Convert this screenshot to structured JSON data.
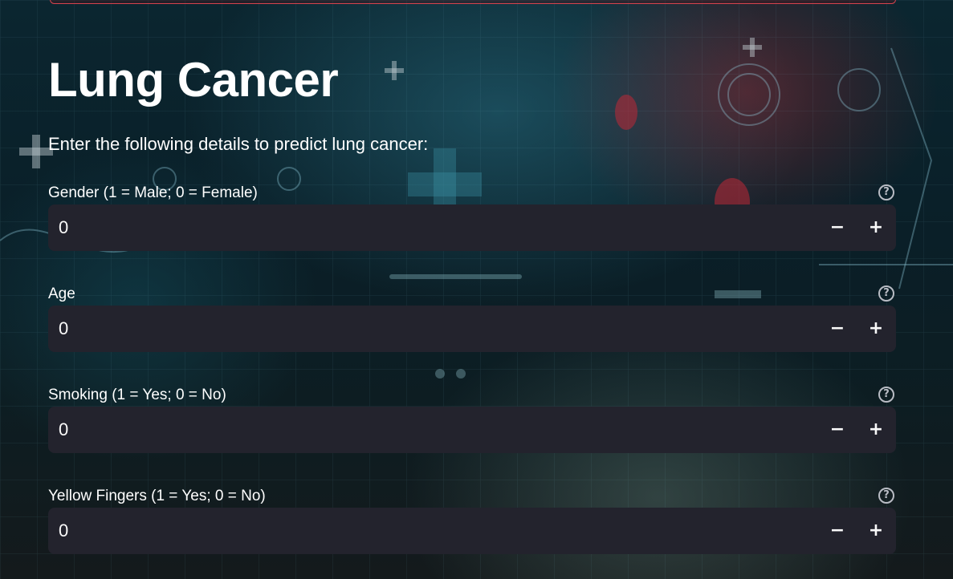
{
  "page": {
    "title": "Lung Cancer",
    "subtitle": "Enter the following details to predict lung cancer:"
  },
  "fields": [
    {
      "label": "Gender (1 = Male; 0 = Female)",
      "value": "0"
    },
    {
      "label": "Age",
      "value": "0"
    },
    {
      "label": "Smoking (1 = Yes; 0 = No)",
      "value": "0"
    },
    {
      "label": "Yellow Fingers (1 = Yes; 0 = No)",
      "value": "0"
    }
  ],
  "icons": {
    "help": "?",
    "minus": "−",
    "plus": "+"
  },
  "colors": {
    "input_background": "#23232d",
    "banner_border": "#d6434e",
    "text": "#ffffff"
  }
}
